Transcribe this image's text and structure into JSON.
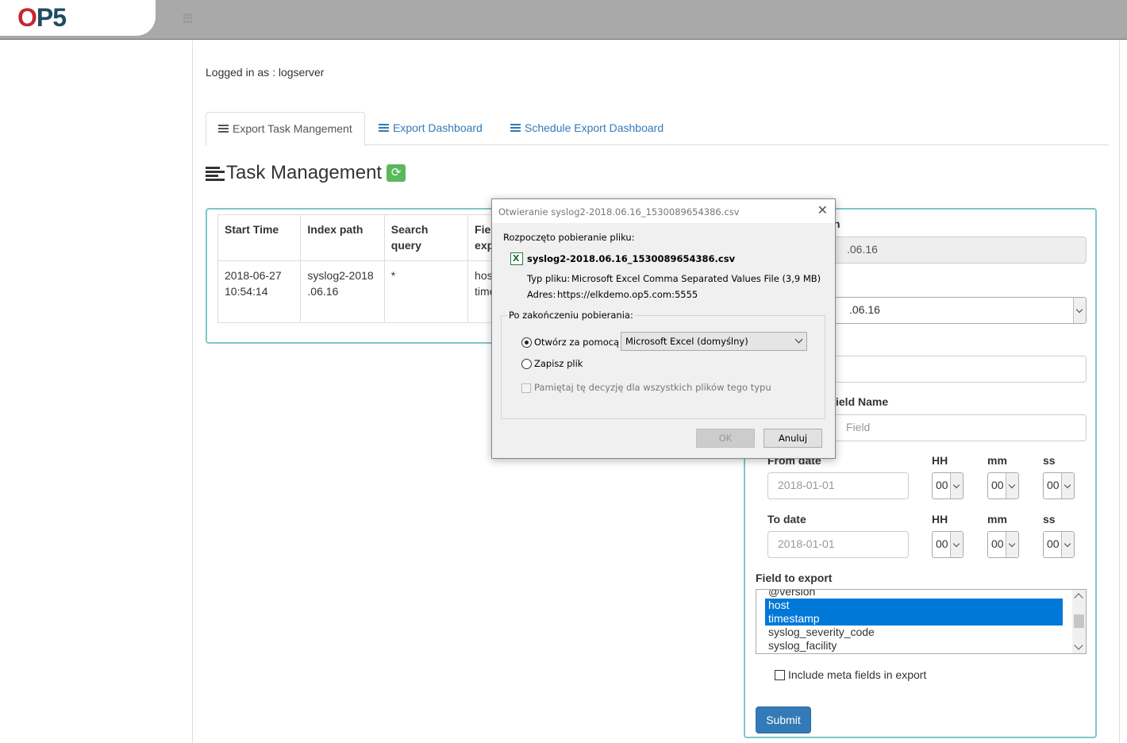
{
  "app": {
    "logo": "OP5"
  },
  "user": {
    "logged_in_text": "Logged in as : logserver"
  },
  "tabs": [
    {
      "label": "Export Task Mangement",
      "active": true,
      "icon": "list-icon"
    },
    {
      "label": "Export Dashboard",
      "active": false,
      "icon": "list-icon"
    },
    {
      "label": "Schedule Export Dashboard",
      "active": false,
      "icon": "list-icon"
    }
  ],
  "page": {
    "title": "Task Management",
    "refresh_icon": "refresh-icon"
  },
  "task_table": {
    "headers": [
      "Start Time",
      "Index path",
      "Search query",
      "Fie exp"
    ],
    "rows": [
      {
        "start_time": "2018-06-27 10:54:14",
        "index_path": "syslog2-2018 .06.16",
        "search_query": "*",
        "fields": "hos time"
      }
    ]
  },
  "form": {
    "index_label_partial": "n",
    "index_value_partial": ".06.16",
    "index_select_partial": ".06.16",
    "field_name_label_partial": "ield Name",
    "field_name_placeholder_partial": "Field",
    "from_date_label": "From date",
    "to_date_label": "To date",
    "hh_label": "HH",
    "mm_label": "mm",
    "ss_label": "ss",
    "from_date_placeholder": "2018-01-01",
    "to_date_placeholder": "2018-01-01",
    "time_value": "00",
    "field_to_export_label": "Field to export",
    "fields": [
      {
        "name": "@version",
        "selected": false
      },
      {
        "name": "host",
        "selected": true
      },
      {
        "name": "timestamp",
        "selected": true
      },
      {
        "name": "syslog_severity_code",
        "selected": false
      },
      {
        "name": "syslog_facility",
        "selected": false
      }
    ],
    "include_meta_label": "Include meta fields in export",
    "submit_label": "Submit"
  },
  "dialog": {
    "title": "Otwieranie syslog2-2018.06.16_1530089654386.csv",
    "started_text": "Rozpoczęto pobieranie pliku:",
    "filename": "syslog2-2018.06.16_1530089654386.csv",
    "type_label": "Typ pliku:",
    "type_value": "Microsoft Excel Comma Separated Values File (3,9 MB)",
    "address_label": "Adres:",
    "address_value": "https://elkdemo.op5.com:5555",
    "after_download_label": "Po zakończeniu pobierania:",
    "open_with_label": "Otwórz za pomocą",
    "open_with_app": "Microsoft Excel (domyślny)",
    "save_label": "Zapisz plik",
    "remember_label": "Pamiętaj tę decyzję dla wszystkich plików tego typu",
    "ok_label": "OK",
    "cancel_label": "Anuluj"
  }
}
